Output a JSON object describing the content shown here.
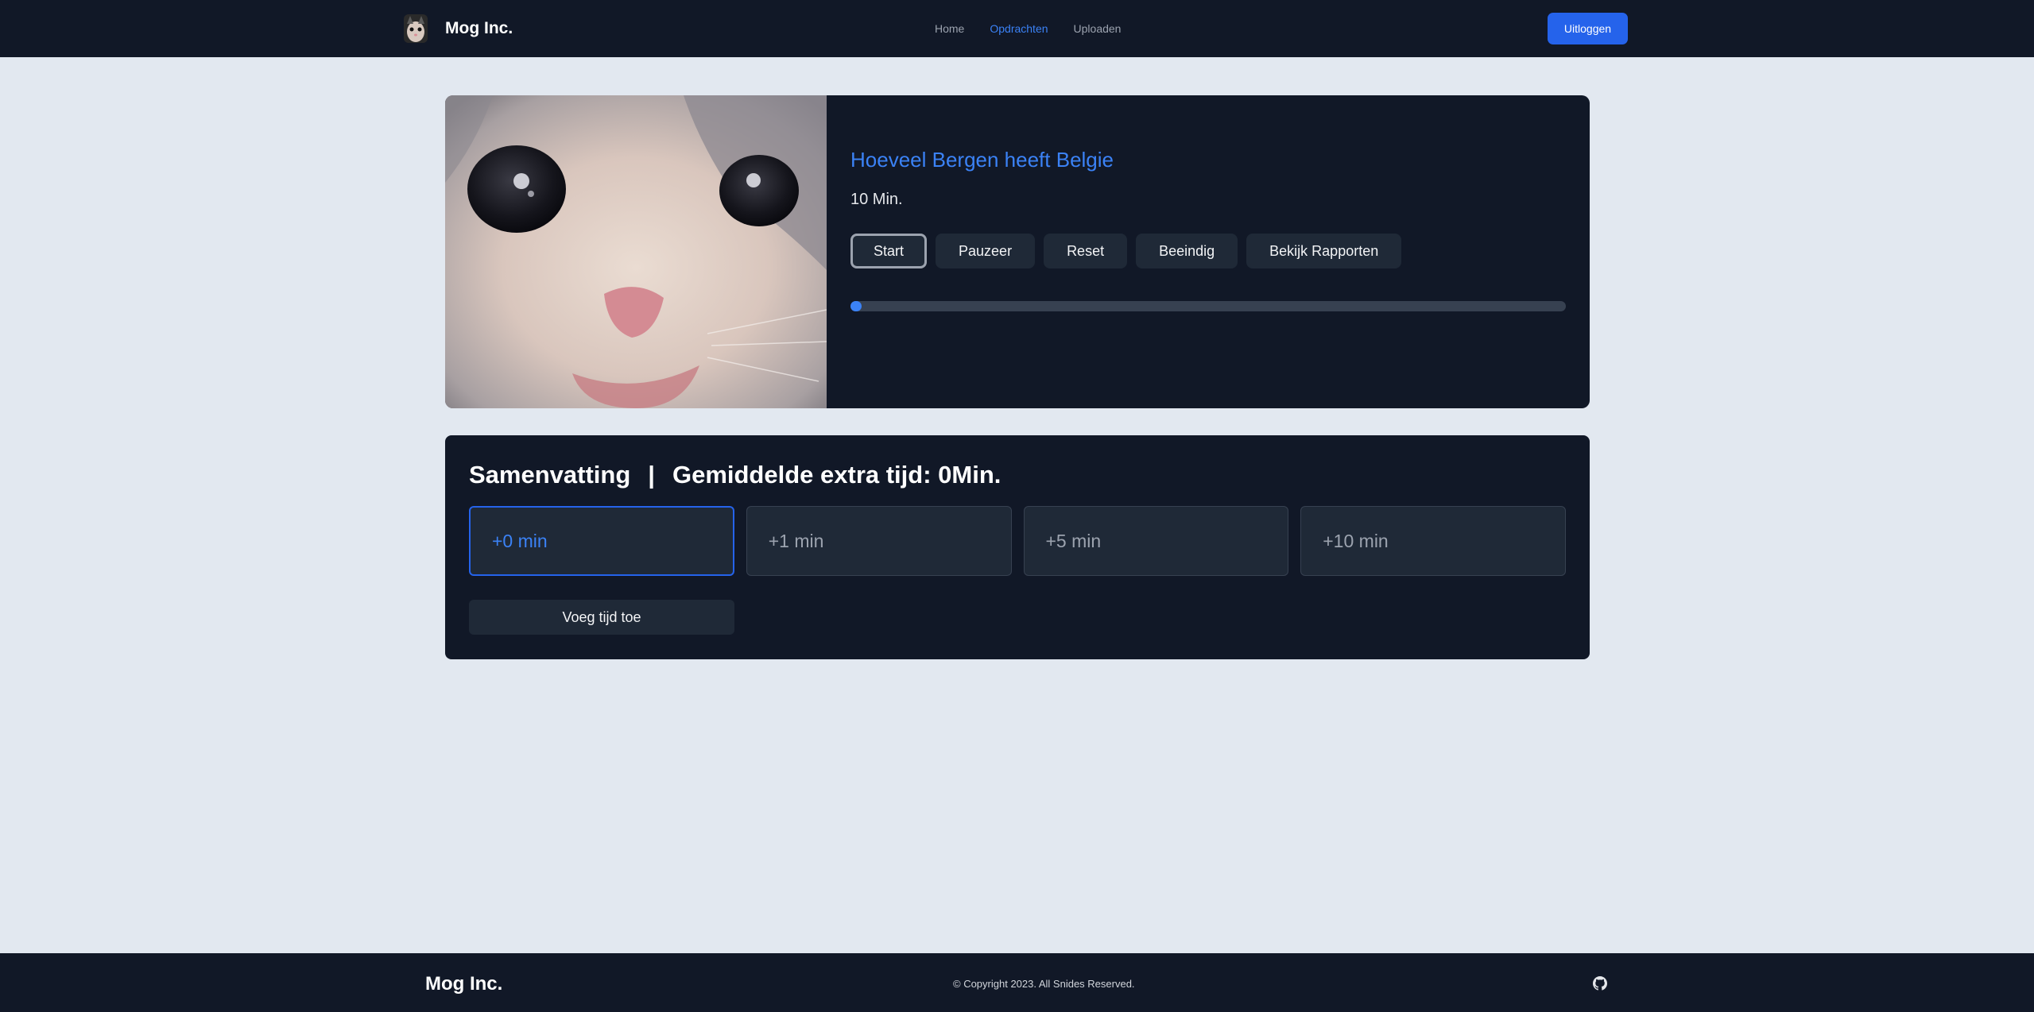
{
  "nav": {
    "brand": "Mog Inc.",
    "links": [
      {
        "label": "Home",
        "active": false
      },
      {
        "label": "Opdrachten",
        "active": true
      },
      {
        "label": "Uploaden",
        "active": false
      }
    ],
    "logout_label": "Uitloggen"
  },
  "task": {
    "title": "Hoeveel Bergen heeft Belgie",
    "duration": "10 Min.",
    "buttons": [
      "Start",
      "Pauzeer",
      "Reset",
      "Beeindig",
      "Bekijk Rapporten"
    ],
    "progress": 0.01
  },
  "summary": {
    "title": "Samenvatting",
    "separator": "|",
    "average_label": "Gemiddelde extra tijd: 0Min.",
    "options": [
      "+0 min",
      "+1 min",
      "+5 min",
      "+10 min"
    ],
    "selected_option": "+0 min",
    "add_button": "Voeg tijd toe"
  },
  "footer": {
    "brand": "Mog Inc.",
    "copyright": "© Copyright 2023. All Snides Reserved."
  },
  "colors": {
    "accent": "#3b82f6",
    "primary_button": "#2563eb",
    "card_bg": "#111827",
    "page_bg": "#e2e8f0"
  },
  "icons": {
    "logo": "cat-avatar-icon",
    "footer": "github-icon"
  }
}
